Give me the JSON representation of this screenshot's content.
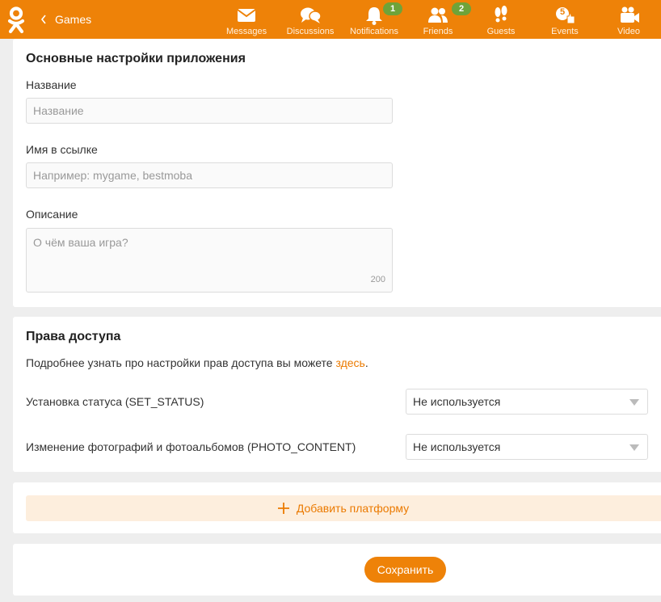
{
  "header": {
    "back_label": "Games",
    "nav": [
      {
        "label": "Messages",
        "icon": "envelope-icon"
      },
      {
        "label": "Discussions",
        "icon": "chat-bubbles-icon"
      },
      {
        "label": "Notifications",
        "icon": "bell-icon",
        "badge": "1"
      },
      {
        "label": "Friends",
        "icon": "friends-icon",
        "badge": "2"
      },
      {
        "label": "Guests",
        "icon": "footprints-icon"
      },
      {
        "label": "Events",
        "icon": "events-icon",
        "count": "5"
      },
      {
        "label": "Video",
        "icon": "video-camera-icon"
      }
    ]
  },
  "basic": {
    "title": "Основные настройки приложения",
    "name_label": "Название",
    "name_placeholder": "Название",
    "link_label": "Имя в ссылке",
    "link_placeholder": "Например: mygame, bestmoba",
    "desc_label": "Описание",
    "desc_placeholder": "О чём ваша игра?",
    "desc_counter": "200"
  },
  "access": {
    "title": "Права доступа",
    "note_prefix": "Подробнее узнать про настройки прав доступа вы можете ",
    "note_link": "здесь",
    "note_suffix": ".",
    "permissions": [
      {
        "label": "Установка статуса (SET_STATUS)",
        "value": "Не используется"
      },
      {
        "label": "Изменение фотографий и фотоальбомов (PHOTO_CONTENT)",
        "value": "Не используется"
      }
    ]
  },
  "platform": {
    "add_label": "Добавить платформу"
  },
  "actions": {
    "save_label": "Сохранить"
  },
  "colors": {
    "brand": "#ee8208",
    "link": "#eb7a00",
    "badge": "#6fa339"
  }
}
